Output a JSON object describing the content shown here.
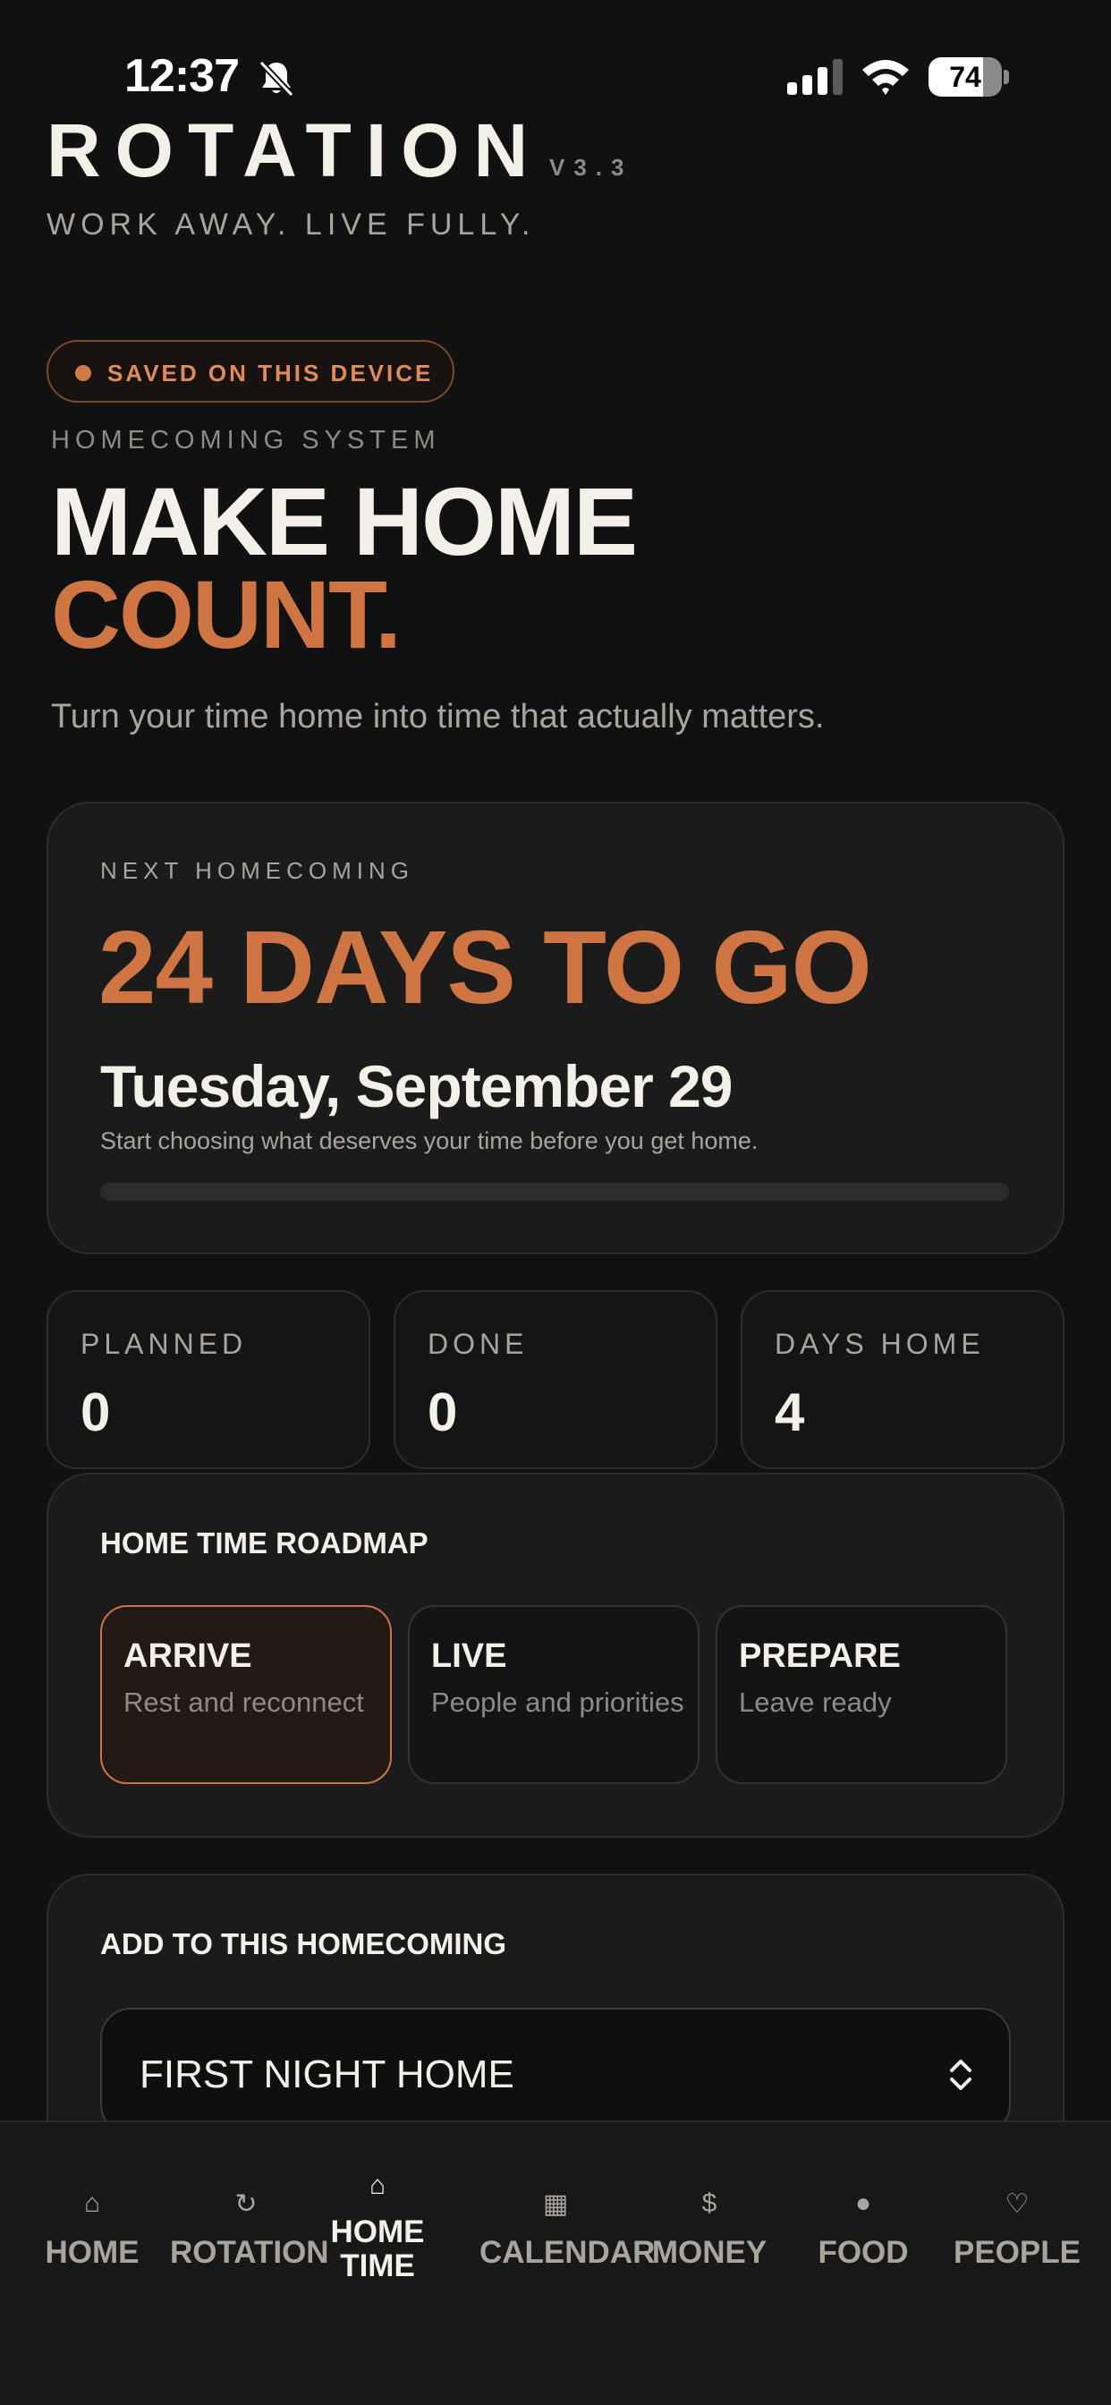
{
  "status_bar": {
    "time": "12:37",
    "battery_level": "74",
    "battery_fraction": 0.74
  },
  "header": {
    "brand": "ROTATION",
    "version": "V3.3",
    "tagline": "WORK AWAY. LIVE FULLY."
  },
  "badge": {
    "label": "SAVED ON THIS DEVICE"
  },
  "hero": {
    "eyebrow": "HOMECOMING SYSTEM",
    "title_line1": "MAKE HOME",
    "title_line2": "COUNT.",
    "subtitle": "Turn your time home into time that actually matters."
  },
  "next_homecoming": {
    "label": "NEXT HOMECOMING",
    "countdown": "24 DAYS TO GO",
    "date": "Tuesday, September 29",
    "hint": "Start choosing what deserves your time before you get home.",
    "progress": 0
  },
  "stats": [
    {
      "label": "PLANNED",
      "value": "0"
    },
    {
      "label": "DONE",
      "value": "0"
    },
    {
      "label": "DAYS HOME",
      "value": "4"
    }
  ],
  "roadmap": {
    "title": "HOME TIME ROADMAP",
    "phases": [
      {
        "title": "ARRIVE",
        "subtitle": "Rest and reconnect",
        "active": true
      },
      {
        "title": "LIVE",
        "subtitle": "People and priorities",
        "active": false
      },
      {
        "title": "PREPARE",
        "subtitle": "Leave ready",
        "active": false
      }
    ]
  },
  "add_section": {
    "title": "ADD TO THIS HOMECOMING",
    "selected": "FIRST NIGHT HOME"
  },
  "tabbar": {
    "tabs": [
      {
        "label": "HOME",
        "icon": "⌂",
        "icon_name": "home-icon"
      },
      {
        "label": "ROTATION",
        "icon": "↻",
        "icon_name": "rotation-icon"
      },
      {
        "label": "HOME TIME",
        "icon": "⌂",
        "icon_name": "home-time-icon",
        "active": true
      },
      {
        "label": "CALENDAR",
        "icon": "▦",
        "icon_name": "calendar-icon"
      },
      {
        "label": "MONEY",
        "icon": "$",
        "icon_name": "money-icon"
      },
      {
        "label": "FOOD",
        "icon": "●",
        "icon_name": "food-icon"
      },
      {
        "label": "PEOPLE",
        "icon": "♡",
        "icon_name": "people-icon"
      }
    ]
  },
  "colors": {
    "background": "#111111",
    "accent": "#cf7443",
    "text": "#f3efe9",
    "muted": "#a9a49d"
  }
}
